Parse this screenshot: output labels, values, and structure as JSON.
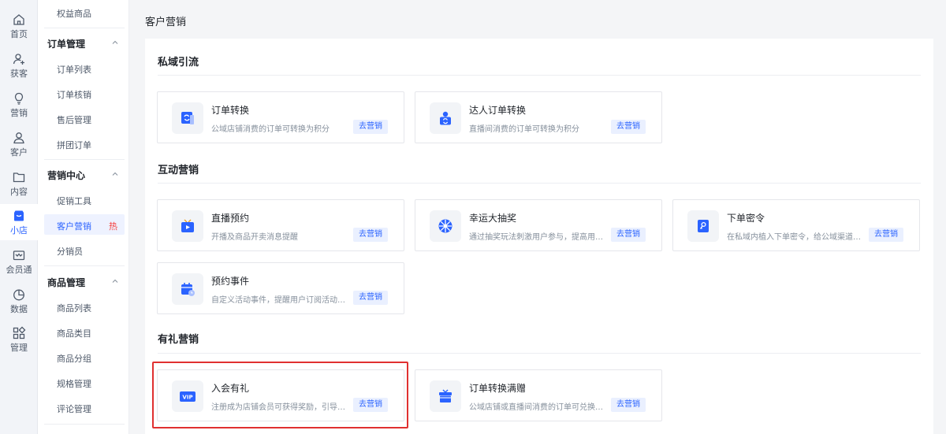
{
  "rail": {
    "items": [
      {
        "label": "首页",
        "icon": "home-icon"
      },
      {
        "label": "获客",
        "icon": "user-plus-icon"
      },
      {
        "label": "营销",
        "icon": "bulb-icon"
      },
      {
        "label": "客户",
        "icon": "user-icon"
      },
      {
        "label": "内容",
        "icon": "folder-icon"
      },
      {
        "label": "小店",
        "icon": "shop-icon",
        "active": true
      },
      {
        "label": "会员通",
        "icon": "member-icon"
      },
      {
        "label": "数据",
        "icon": "pie-chart-icon"
      },
      {
        "label": "管理",
        "icon": "grid-icon"
      }
    ]
  },
  "menu": {
    "top_item": "权益商品",
    "groups": [
      {
        "title": "订单管理",
        "items": [
          "订单列表",
          "订单核销",
          "售后管理",
          "拼团订单"
        ]
      },
      {
        "title": "营销中心",
        "items": [
          "促销工具",
          "客户营销",
          "分销员"
        ],
        "active_item": "客户营销",
        "hot_badge": "热"
      },
      {
        "title": "商品管理",
        "items": [
          "商品列表",
          "商品类目",
          "商品分组",
          "规格管理",
          "评论管理"
        ]
      }
    ]
  },
  "page": {
    "title": "客户营销"
  },
  "sections": [
    {
      "title": "私域引流",
      "cards": [
        {
          "title": "订单转换",
          "desc": "公域店铺消费的订单可转换为积分",
          "button": "去营销",
          "icon": "order-convert-icon"
        },
        {
          "title": "达人订单转换",
          "desc": "直播间消费的订单可转换为积分",
          "button": "去营销",
          "icon": "influencer-order-icon"
        }
      ]
    },
    {
      "title": "互动营销",
      "cards": [
        {
          "title": "直播预约",
          "desc": "开播及商品开卖消息提醒",
          "button": "去营销",
          "icon": "live-tv-icon"
        },
        {
          "title": "幸运大抽奖",
          "desc": "通过抽奖玩法刺激用户参与，提高用…",
          "button": "去营销",
          "icon": "lottery-wheel-icon"
        },
        {
          "title": "下单密令",
          "desc": "在私域内植入下单密令，给公域渠道…",
          "button": "去营销",
          "icon": "key-book-icon"
        },
        {
          "title": "预约事件",
          "desc": "自定义活动事件，提醒用户订阅活动…",
          "button": "去营销",
          "icon": "calendar-clock-icon"
        }
      ]
    },
    {
      "title": "有礼营销",
      "cards": [
        {
          "title": "入会有礼",
          "desc": "注册成为店铺会员可获得奖励，引导…",
          "button": "去营销",
          "icon": "vip-icon",
          "icon_text": "VIP"
        },
        {
          "title": "订单转换满赠",
          "desc": "公域店铺或直播间消费的订单可兑换…",
          "button": "去营销",
          "icon": "gift-box-icon"
        }
      ]
    }
  ],
  "colors": {
    "accent": "#2b63ff",
    "highlight": "#e03030",
    "hot": "#f53f3f"
  }
}
